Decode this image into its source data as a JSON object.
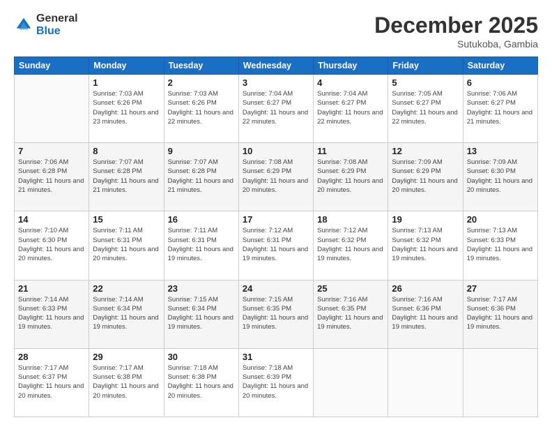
{
  "logo": {
    "general": "General",
    "blue": "Blue"
  },
  "header": {
    "month": "December 2025",
    "location": "Sutukoba, Gambia"
  },
  "weekdays": [
    "Sunday",
    "Monday",
    "Tuesday",
    "Wednesday",
    "Thursday",
    "Friday",
    "Saturday"
  ],
  "weeks": [
    [
      {
        "day": "",
        "sunrise": "",
        "sunset": "",
        "daylight": ""
      },
      {
        "day": "1",
        "sunrise": "Sunrise: 7:03 AM",
        "sunset": "Sunset: 6:26 PM",
        "daylight": "Daylight: 11 hours and 23 minutes."
      },
      {
        "day": "2",
        "sunrise": "Sunrise: 7:03 AM",
        "sunset": "Sunset: 6:26 PM",
        "daylight": "Daylight: 11 hours and 22 minutes."
      },
      {
        "day": "3",
        "sunrise": "Sunrise: 7:04 AM",
        "sunset": "Sunset: 6:27 PM",
        "daylight": "Daylight: 11 hours and 22 minutes."
      },
      {
        "day": "4",
        "sunrise": "Sunrise: 7:04 AM",
        "sunset": "Sunset: 6:27 PM",
        "daylight": "Daylight: 11 hours and 22 minutes."
      },
      {
        "day": "5",
        "sunrise": "Sunrise: 7:05 AM",
        "sunset": "Sunset: 6:27 PM",
        "daylight": "Daylight: 11 hours and 22 minutes."
      },
      {
        "day": "6",
        "sunrise": "Sunrise: 7:06 AM",
        "sunset": "Sunset: 6:27 PM",
        "daylight": "Daylight: 11 hours and 21 minutes."
      }
    ],
    [
      {
        "day": "7",
        "sunrise": "Sunrise: 7:06 AM",
        "sunset": "Sunset: 6:28 PM",
        "daylight": "Daylight: 11 hours and 21 minutes."
      },
      {
        "day": "8",
        "sunrise": "Sunrise: 7:07 AM",
        "sunset": "Sunset: 6:28 PM",
        "daylight": "Daylight: 11 hours and 21 minutes."
      },
      {
        "day": "9",
        "sunrise": "Sunrise: 7:07 AM",
        "sunset": "Sunset: 6:28 PM",
        "daylight": "Daylight: 11 hours and 21 minutes."
      },
      {
        "day": "10",
        "sunrise": "Sunrise: 7:08 AM",
        "sunset": "Sunset: 6:29 PM",
        "daylight": "Daylight: 11 hours and 20 minutes."
      },
      {
        "day": "11",
        "sunrise": "Sunrise: 7:08 AM",
        "sunset": "Sunset: 6:29 PM",
        "daylight": "Daylight: 11 hours and 20 minutes."
      },
      {
        "day": "12",
        "sunrise": "Sunrise: 7:09 AM",
        "sunset": "Sunset: 6:29 PM",
        "daylight": "Daylight: 11 hours and 20 minutes."
      },
      {
        "day": "13",
        "sunrise": "Sunrise: 7:09 AM",
        "sunset": "Sunset: 6:30 PM",
        "daylight": "Daylight: 11 hours and 20 minutes."
      }
    ],
    [
      {
        "day": "14",
        "sunrise": "Sunrise: 7:10 AM",
        "sunset": "Sunset: 6:30 PM",
        "daylight": "Daylight: 11 hours and 20 minutes."
      },
      {
        "day": "15",
        "sunrise": "Sunrise: 7:11 AM",
        "sunset": "Sunset: 6:31 PM",
        "daylight": "Daylight: 11 hours and 20 minutes."
      },
      {
        "day": "16",
        "sunrise": "Sunrise: 7:11 AM",
        "sunset": "Sunset: 6:31 PM",
        "daylight": "Daylight: 11 hours and 19 minutes."
      },
      {
        "day": "17",
        "sunrise": "Sunrise: 7:12 AM",
        "sunset": "Sunset: 6:31 PM",
        "daylight": "Daylight: 11 hours and 19 minutes."
      },
      {
        "day": "18",
        "sunrise": "Sunrise: 7:12 AM",
        "sunset": "Sunset: 6:32 PM",
        "daylight": "Daylight: 11 hours and 19 minutes."
      },
      {
        "day": "19",
        "sunrise": "Sunrise: 7:13 AM",
        "sunset": "Sunset: 6:32 PM",
        "daylight": "Daylight: 11 hours and 19 minutes."
      },
      {
        "day": "20",
        "sunrise": "Sunrise: 7:13 AM",
        "sunset": "Sunset: 6:33 PM",
        "daylight": "Daylight: 11 hours and 19 minutes."
      }
    ],
    [
      {
        "day": "21",
        "sunrise": "Sunrise: 7:14 AM",
        "sunset": "Sunset: 6:33 PM",
        "daylight": "Daylight: 11 hours and 19 minutes."
      },
      {
        "day": "22",
        "sunrise": "Sunrise: 7:14 AM",
        "sunset": "Sunset: 6:34 PM",
        "daylight": "Daylight: 11 hours and 19 minutes."
      },
      {
        "day": "23",
        "sunrise": "Sunrise: 7:15 AM",
        "sunset": "Sunset: 6:34 PM",
        "daylight": "Daylight: 11 hours and 19 minutes."
      },
      {
        "day": "24",
        "sunrise": "Sunrise: 7:15 AM",
        "sunset": "Sunset: 6:35 PM",
        "daylight": "Daylight: 11 hours and 19 minutes."
      },
      {
        "day": "25",
        "sunrise": "Sunrise: 7:16 AM",
        "sunset": "Sunset: 6:35 PM",
        "daylight": "Daylight: 11 hours and 19 minutes."
      },
      {
        "day": "26",
        "sunrise": "Sunrise: 7:16 AM",
        "sunset": "Sunset: 6:36 PM",
        "daylight": "Daylight: 11 hours and 19 minutes."
      },
      {
        "day": "27",
        "sunrise": "Sunrise: 7:17 AM",
        "sunset": "Sunset: 6:36 PM",
        "daylight": "Daylight: 11 hours and 19 minutes."
      }
    ],
    [
      {
        "day": "28",
        "sunrise": "Sunrise: 7:17 AM",
        "sunset": "Sunset: 6:37 PM",
        "daylight": "Daylight: 11 hours and 20 minutes."
      },
      {
        "day": "29",
        "sunrise": "Sunrise: 7:17 AM",
        "sunset": "Sunset: 6:38 PM",
        "daylight": "Daylight: 11 hours and 20 minutes."
      },
      {
        "day": "30",
        "sunrise": "Sunrise: 7:18 AM",
        "sunset": "Sunset: 6:38 PM",
        "daylight": "Daylight: 11 hours and 20 minutes."
      },
      {
        "day": "31",
        "sunrise": "Sunrise: 7:18 AM",
        "sunset": "Sunset: 6:39 PM",
        "daylight": "Daylight: 11 hours and 20 minutes."
      },
      {
        "day": "",
        "sunrise": "",
        "sunset": "",
        "daylight": ""
      },
      {
        "day": "",
        "sunrise": "",
        "sunset": "",
        "daylight": ""
      },
      {
        "day": "",
        "sunrise": "",
        "sunset": "",
        "daylight": ""
      }
    ]
  ]
}
